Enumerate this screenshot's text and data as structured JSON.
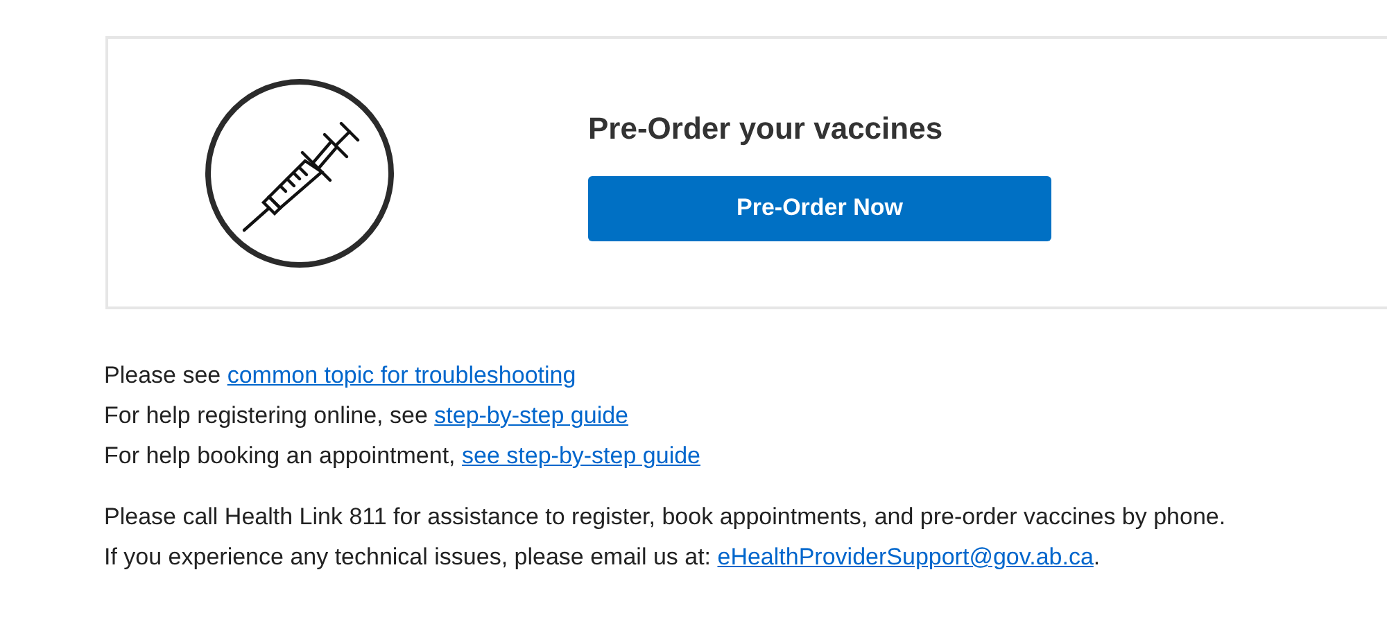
{
  "card": {
    "title": "Pre-Order your vaccines",
    "button": "Pre-Order Now"
  },
  "help_lines": [
    {
      "text": "Please see ",
      "link": "common topic for troubleshooting"
    },
    {
      "text": "For help registering online, see ",
      "link": "step-by-step guide"
    },
    {
      "text": "For help booking an appointment, ",
      "link": "see step-by-step guide"
    }
  ],
  "contact_lines": [
    {
      "text": "Please call Health Link 811 for assistance to register, book appointments, and pre-order vaccines by phone."
    },
    {
      "text": "If you experience any technical issues, please email us at: ",
      "link": "eHealthProviderSupport@gov.ab.ca",
      "after": "."
    }
  ]
}
